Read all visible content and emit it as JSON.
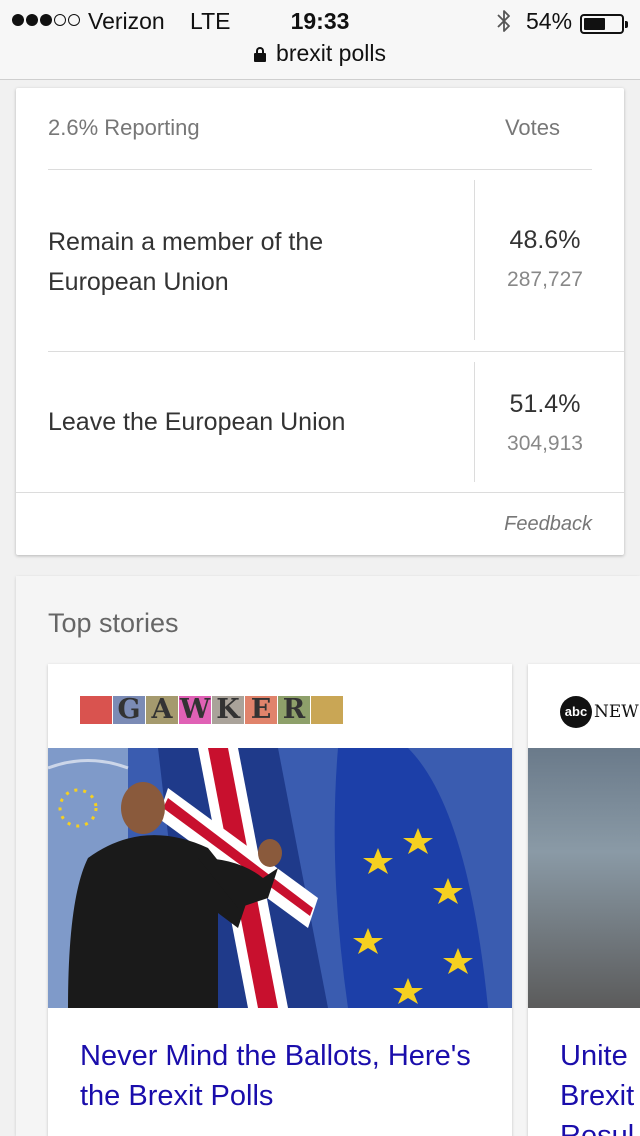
{
  "status_bar": {
    "carrier": "Verizon",
    "network": "LTE",
    "time": "19:33",
    "battery_percent": "54%",
    "battery_level": 0.54,
    "signal_bars_filled": 3,
    "signal_bars_total": 5,
    "url": "brexit polls"
  },
  "results": {
    "reporting": "2.6% Reporting",
    "votes_header": "Votes",
    "rows": [
      {
        "choice": "Remain a member of the European Union",
        "percent": "48.6%",
        "votes": "287,727"
      },
      {
        "choice": "Leave the European Union",
        "percent": "51.4%",
        "votes": "304,913"
      }
    ],
    "feedback": "Feedback"
  },
  "top_stories": {
    "title": "Top stories",
    "stories": [
      {
        "source_logo_letters": [
          "",
          "G",
          "A",
          "W",
          "K",
          "E",
          "R",
          ""
        ],
        "source_logo_colors": [
          "#d9534f",
          "#7b8bb5",
          "#a59a6e",
          "#e061b5",
          "#aaa39a",
          "#e0836b",
          "#8ea06a",
          "#c9a655"
        ],
        "headline": "Never Mind the Ballots, Here's the Brexit Polls"
      },
      {
        "source_logo": "abcNEWS",
        "source_logo_circle": "abc",
        "source_logo_text": "NEWS",
        "headline_line1": "Unite",
        "headline_line2": "Brexit",
        "headline_line3": "Resul"
      }
    ]
  }
}
